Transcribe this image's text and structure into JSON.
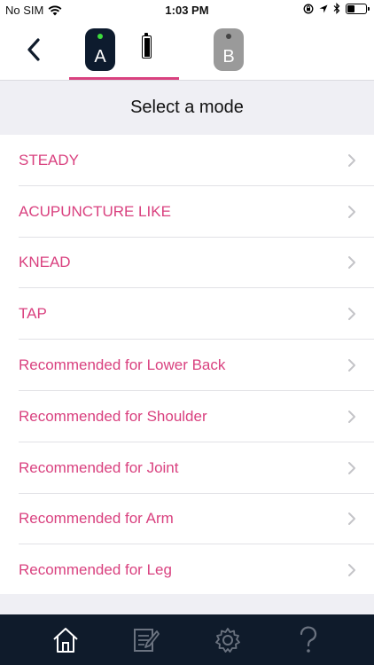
{
  "status_bar": {
    "carrier": "No SIM",
    "time": "1:03 PM"
  },
  "header": {
    "device_a_label": "A",
    "device_b_label": "B",
    "active_device": "A"
  },
  "section_title": "Select a mode",
  "modes": [
    {
      "label": "STEADY"
    },
    {
      "label": "ACUPUNCTURE LIKE"
    },
    {
      "label": "KNEAD"
    },
    {
      "label": "TAP"
    },
    {
      "label": "Recommended for Lower Back"
    },
    {
      "label": "Recommended for Shoulder"
    },
    {
      "label": "Recommended for Joint"
    },
    {
      "label": "Recommended for Arm"
    },
    {
      "label": "Recommended for Leg"
    }
  ],
  "tab_bar": {
    "items": [
      "home-icon",
      "notes-icon",
      "settings-gear-icon",
      "help-question-icon"
    ]
  },
  "colors": {
    "accent": "#d9417f",
    "tab_bar_bg": "#0f1b2b",
    "device_a_bg": "#0d1b2e",
    "device_b_bg": "#9a9a9a",
    "status_led": "#3ddc3d",
    "section_bg": "#efeff4"
  }
}
